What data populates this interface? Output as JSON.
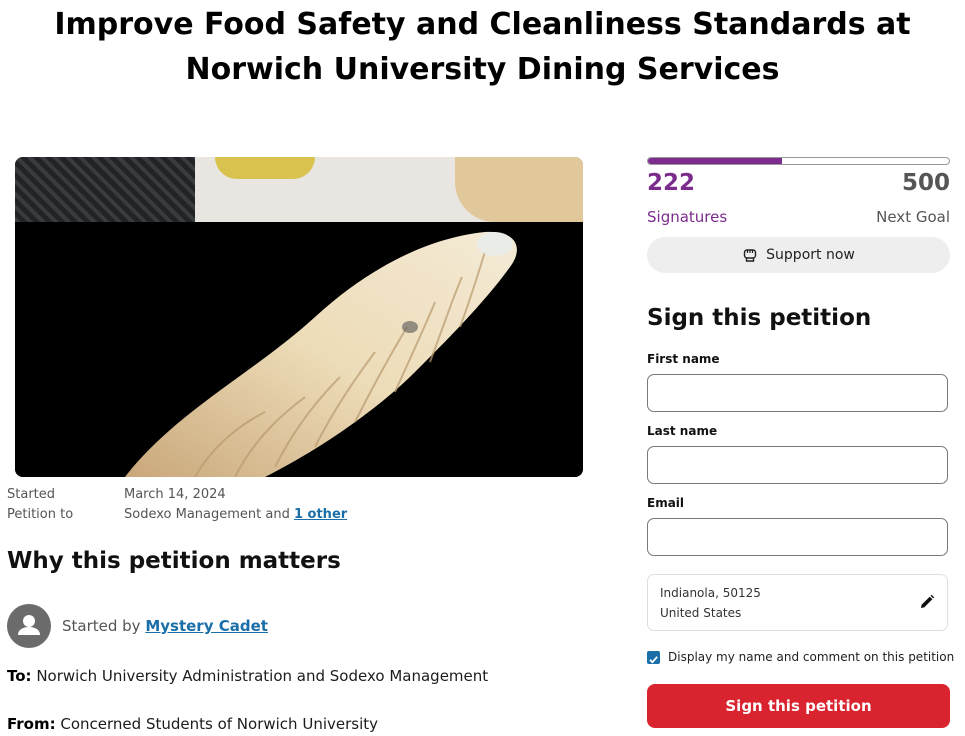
{
  "title": "Improve Food Safety and Cleanliness Standards at Norwich University Dining Services",
  "meta": {
    "started_label": "Started",
    "started_value": "March 14, 2024",
    "petition_to_label": "Petition to",
    "petition_to_value": "Sodexo Management and ",
    "petition_to_link": "1 other"
  },
  "section_heading": "Why this petition matters",
  "starter": {
    "prefix": "Started by ",
    "name": "Mystery Cadet"
  },
  "body": {
    "to_label": "To:",
    "to_text": " Norwich University Administration and Sodexo Management",
    "from_label": "From:",
    "from_text": " Concerned Students of Norwich University"
  },
  "progress": {
    "signatures": "222",
    "goal": "500",
    "fraction": 0.444,
    "signatures_label": "Signatures",
    "goal_label": "Next Goal",
    "support_label": "Support now"
  },
  "form": {
    "title": "Sign this petition",
    "first_name_label": "First name",
    "first_name_value": "",
    "last_name_label": "Last name",
    "last_name_value": "",
    "email_label": "Email",
    "email_value": "",
    "location_line1": "Indianola, 50125",
    "location_line2": "United States",
    "display_checkbox_label": "Display my name and comment on this petition",
    "display_checked": true,
    "submit_label": "Sign this petition"
  },
  "icons": {
    "support": "raised-fist-icon",
    "edit": "pencil-icon",
    "avatar": "user-icon"
  },
  "colors": {
    "accent_purple": "#7b2c8c",
    "cta_red": "#d9232e",
    "link_blue": "#1a6fa8"
  }
}
